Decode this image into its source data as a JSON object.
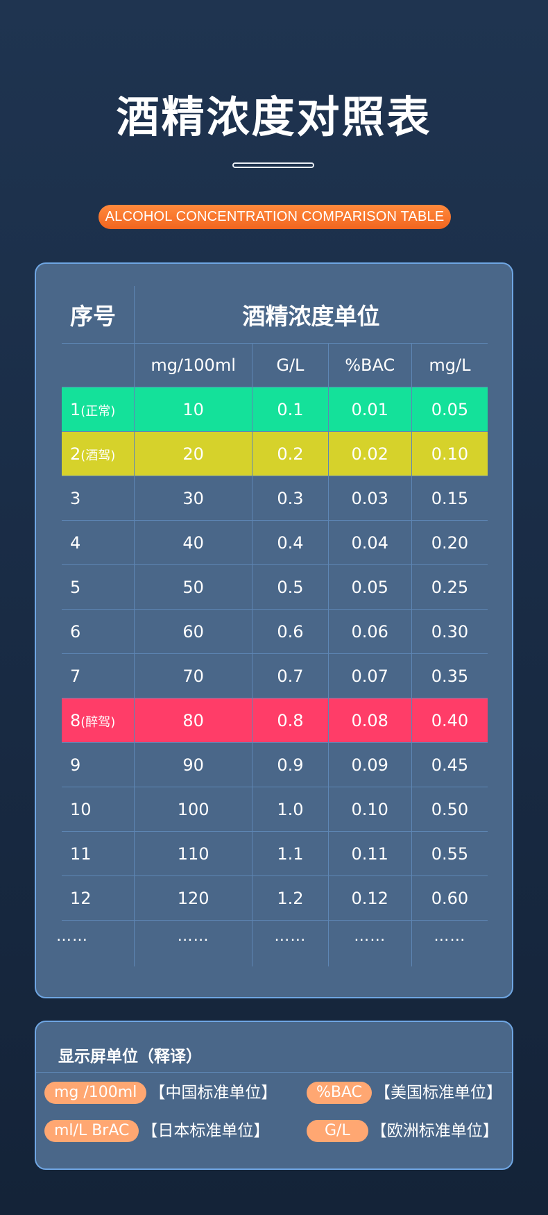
{
  "title": "酒精浓度对照表",
  "subtitle_en": "ALCOHOL CONCENTRATION COMPARISON TABLE",
  "table": {
    "index_header": "序号",
    "units_header": "酒精浓度单位",
    "columns": [
      "mg/100ml",
      "G/L",
      "%BAC",
      "mg/L"
    ],
    "rows": [
      {
        "no": "1",
        "tag": "(正常)",
        "values": [
          "10",
          "0.1",
          "0.01",
          "0.05"
        ],
        "highlight": "#14e19a"
      },
      {
        "no": "2",
        "tag": "(酒驾)",
        "values": [
          "20",
          "0.2",
          "0.02",
          "0.10"
        ],
        "highlight": "#d6d22b"
      },
      {
        "no": "3",
        "tag": "",
        "values": [
          "30",
          "0.3",
          "0.03",
          "0.15"
        ]
      },
      {
        "no": "4",
        "tag": "",
        "values": [
          "40",
          "0.4",
          "0.04",
          "0.20"
        ]
      },
      {
        "no": "5",
        "tag": "",
        "values": [
          "50",
          "0.5",
          "0.05",
          "0.25"
        ]
      },
      {
        "no": "6",
        "tag": "",
        "values": [
          "60",
          "0.6",
          "0.06",
          "0.30"
        ]
      },
      {
        "no": "7",
        "tag": "",
        "values": [
          "70",
          "0.7",
          "0.07",
          "0.35"
        ]
      },
      {
        "no": "8",
        "tag": "(醉驾)",
        "values": [
          "80",
          "0.8",
          "0.08",
          "0.40"
        ],
        "highlight": "#ff3d68"
      },
      {
        "no": "9",
        "tag": "",
        "values": [
          "90",
          "0.9",
          "0.09",
          "0.45"
        ]
      },
      {
        "no": "10",
        "tag": "",
        "values": [
          "100",
          "1.0",
          "0.10",
          "0.50"
        ]
      },
      {
        "no": "11",
        "tag": "",
        "values": [
          "110",
          "1.1",
          "0.11",
          "0.55"
        ]
      },
      {
        "no": "12",
        "tag": "",
        "values": [
          "120",
          "1.2",
          "0.12",
          "0.60"
        ]
      }
    ],
    "ellipsis": "……"
  },
  "units": {
    "title": "显示屏单位（释译）",
    "items": [
      {
        "chip": "mg /100ml",
        "desc": "【中国标准单位】"
      },
      {
        "chip": "%BAC",
        "desc": "【美国标准单位】"
      },
      {
        "chip": "ml/L BrAC",
        "desc": "【日本标准单位】"
      },
      {
        "chip": "G/L",
        "desc": "【欧洲标准单位】"
      }
    ]
  },
  "colors": {
    "background": "#1f3450",
    "card": "#4a6789",
    "accent_orange": "#f2651f",
    "chip_orange": "#ffa772",
    "normal_green": "#14e19a",
    "drink_yellow": "#d6d22b",
    "drunk_red": "#ff3d68"
  }
}
